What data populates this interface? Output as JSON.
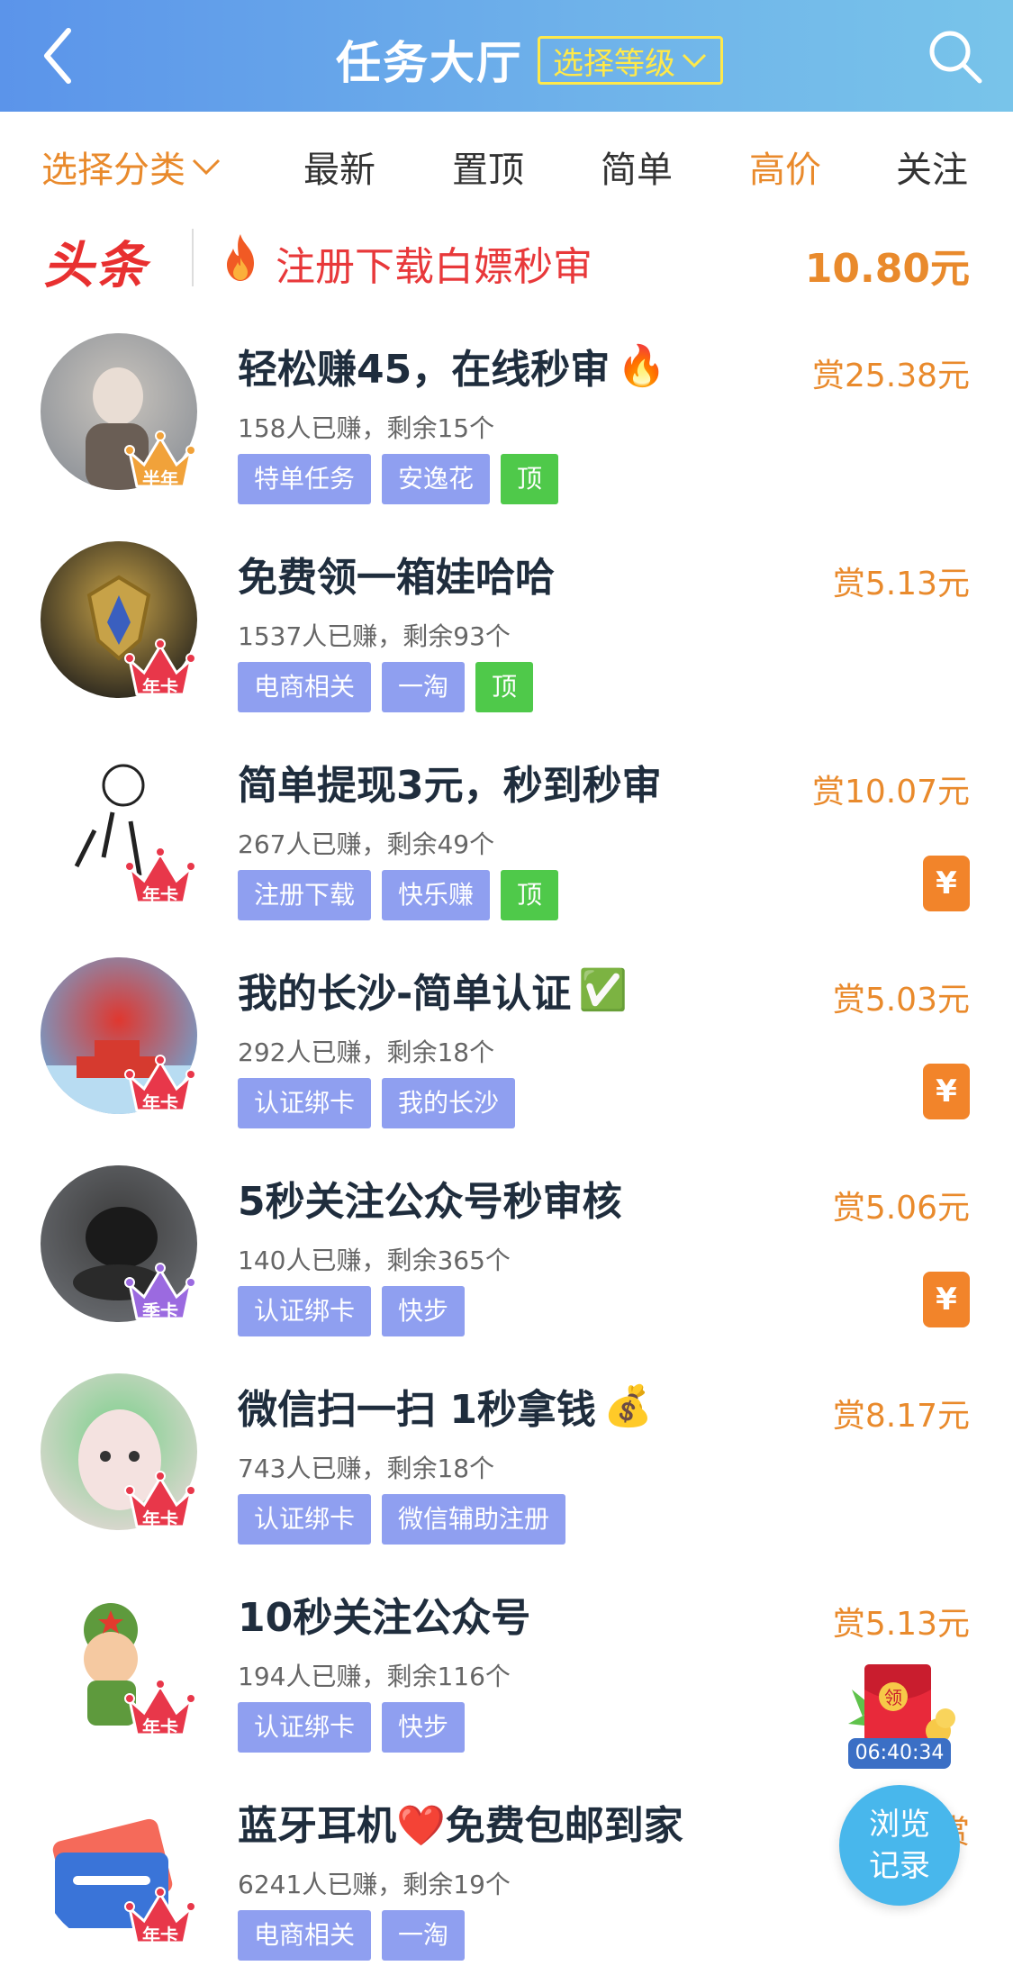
{
  "header": {
    "title": "任务大厅",
    "level_select": "选择等级"
  },
  "filters": {
    "category": "选择分类",
    "items": [
      "最新",
      "置顶",
      "简单",
      "高价",
      "关注"
    ]
  },
  "headline": {
    "logo": "头条",
    "text": "注册下载白嫖秒审",
    "price": "10.80元"
  },
  "tasks": [
    {
      "title": "轻松赚45，在线秒审",
      "emoji": "🔥",
      "stats": "158人已赚，剩余15个",
      "tags": [
        "特单任务",
        "安逸花"
      ],
      "top": "顶",
      "reward": "赏25.38元",
      "badge": "半年",
      "badge_color": "#f1a23a",
      "yuan": ""
    },
    {
      "title": "免费领一箱娃哈哈",
      "emoji": "",
      "stats": "1537人已赚，剩余93个",
      "tags": [
        "电商相关",
        "一淘"
      ],
      "top": "顶",
      "reward": "赏5.13元",
      "badge": "年卡",
      "badge_color": "#e8374a",
      "yuan": ""
    },
    {
      "title": "简单提现3元，秒到秒审",
      "emoji": "",
      "stats": "267人已赚，剩余49个",
      "tags": [
        "注册下载",
        "快乐赚"
      ],
      "top": "顶",
      "reward": "赏10.07元",
      "badge": "年卡",
      "badge_color": "#e8374a",
      "yuan": "¥"
    },
    {
      "title": "我的长沙-简单认证",
      "emoji": "✅",
      "stats": "292人已赚，剩余18个",
      "tags": [
        "认证绑卡",
        "我的长沙"
      ],
      "top": "",
      "reward": "赏5.03元",
      "badge": "年卡",
      "badge_color": "#e8374a",
      "yuan": "¥"
    },
    {
      "title": "5秒关注公众号秒审核",
      "emoji": "",
      "stats": "140人已赚，剩余365个",
      "tags": [
        "认证绑卡",
        "快步"
      ],
      "top": "",
      "reward": "赏5.06元",
      "badge": "季卡",
      "badge_color": "#9b6ae0",
      "yuan": "¥"
    },
    {
      "title": "微信扫一扫 1秒拿钱",
      "emoji": "💰",
      "stats": "743人已赚，剩余18个",
      "tags": [
        "认证绑卡",
        "微信辅助注册"
      ],
      "top": "",
      "reward": "赏8.17元",
      "badge": "年卡",
      "badge_color": "#e8374a",
      "yuan": ""
    },
    {
      "title": "10秒关注公众号",
      "emoji": "",
      "stats": "194人已赚，剩余116个",
      "tags": [
        "认证绑卡",
        "快步"
      ],
      "top": "",
      "reward": "赏5.13元",
      "badge": "年卡",
      "badge_color": "#e8374a",
      "yuan": ""
    },
    {
      "title": "蓝牙耳机❤️免费包邮到家",
      "emoji": "",
      "stats": "6241人已赚，剩余19个",
      "tags": [
        "电商相关",
        "一淘"
      ],
      "top": "",
      "reward": "赏",
      "badge": "年卡",
      "badge_color": "#e8374a",
      "yuan": ""
    }
  ],
  "floating": {
    "redpacket_label": "领",
    "timer": "06:40:34",
    "browse_line1": "浏览",
    "browse_line2": "记录"
  }
}
